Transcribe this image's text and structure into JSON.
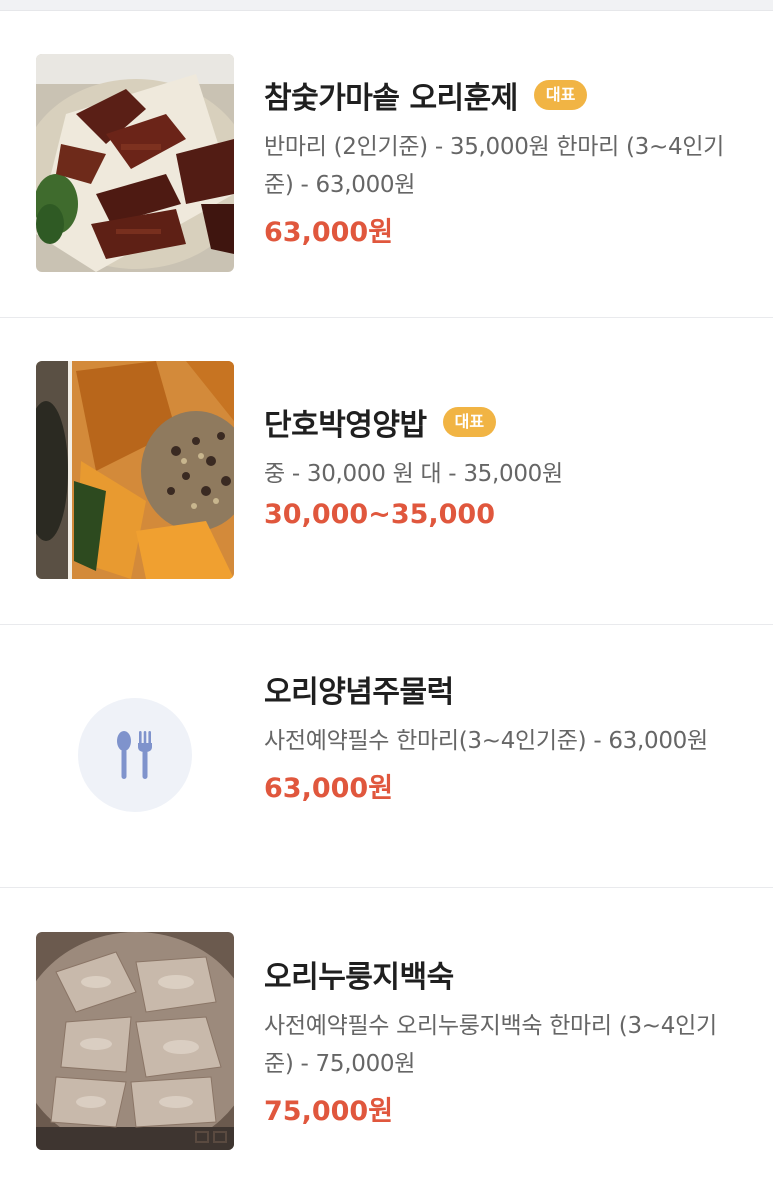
{
  "menu": {
    "items": [
      {
        "name": "참숯가마솥 오리훈제",
        "badge": "대표",
        "description": "반마리 (2인기준) - 35,000원 한마리 (3~4인기준) - 63,000원",
        "price": "63,000원",
        "image": "smoked-duck-photo"
      },
      {
        "name": "단호박영양밥",
        "badge": "대표",
        "description": "중 - 30,000 원 대 - 35,000원",
        "price": "30,000~35,000",
        "image": "pumpkin-rice-photo"
      },
      {
        "name": "오리양념주물럭",
        "description": "사전예약필수 한마리(3~4인기준) - 63,000원",
        "price": "63,000원",
        "image": "utensils-icon"
      },
      {
        "name": "오리누룽지백숙",
        "description": "사전예약필수 오리누룽지백숙 한마리 (3~4인기준) - 75,000원",
        "price": "75,000원",
        "image": "boiled-duck-photo"
      }
    ]
  },
  "colors": {
    "price": "#e0573d",
    "badge": "#f1b444",
    "placeholder_bg": "#eff2f8",
    "placeholder_icon": "#7f93cc"
  }
}
